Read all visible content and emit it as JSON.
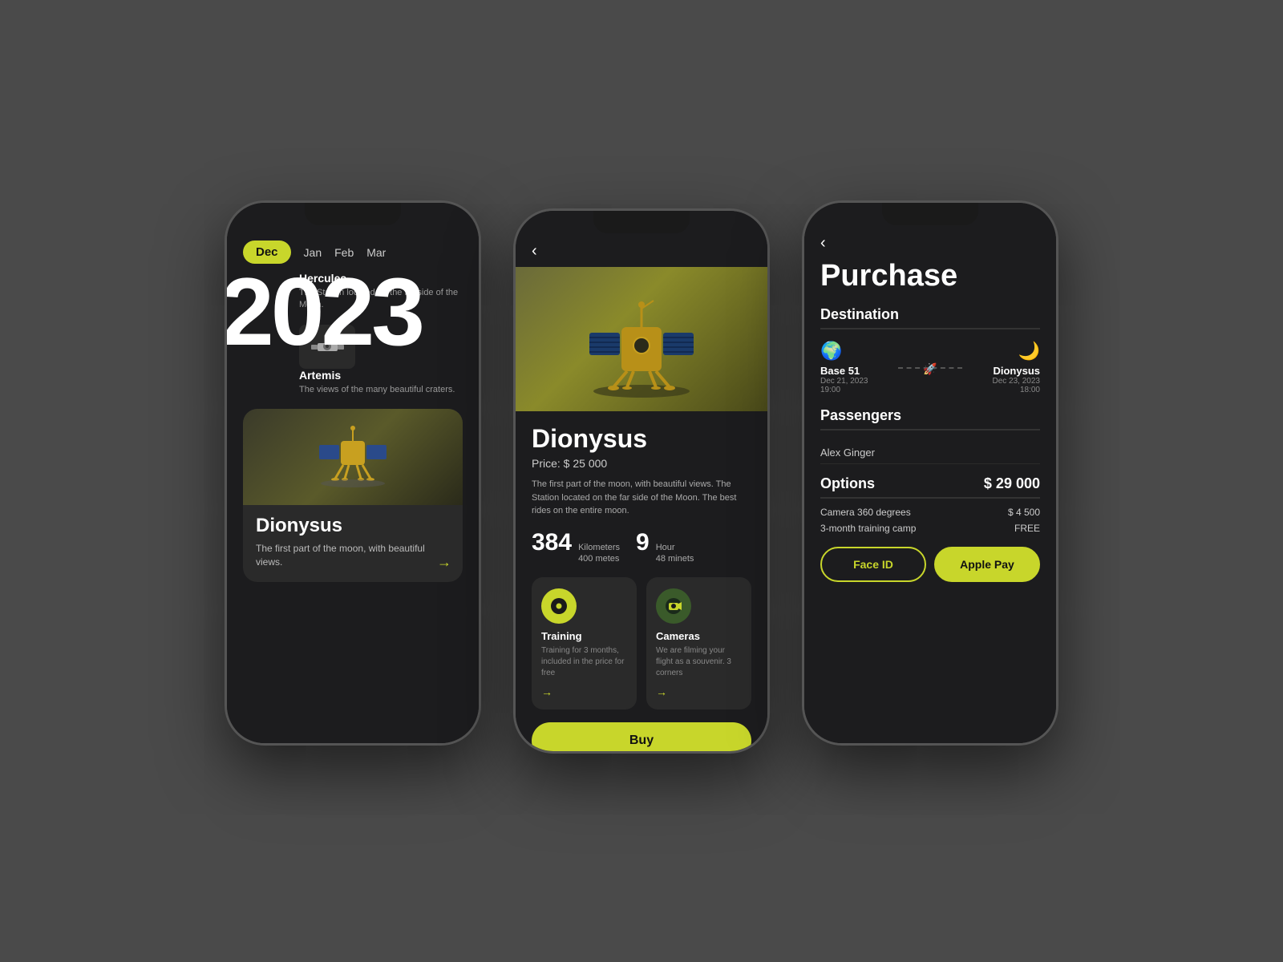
{
  "bg": "#4a4a4a",
  "phone1": {
    "months": [
      "Dec",
      "Jan",
      "Feb",
      "Mar"
    ],
    "active_month": "Dec",
    "year": "2023",
    "missions": [
      {
        "name": "Hercules",
        "desc": "The Station located on the far side of the Moon."
      },
      {
        "name": "Artemis",
        "desc": "The views of the many beautiful craters."
      }
    ],
    "featured": {
      "title": "Dionysus",
      "desc": "The first part of the moon, with beautiful views."
    }
  },
  "phone2": {
    "back_icon": "‹",
    "title": "Dionysus",
    "price": "Price: $ 25 000",
    "desc": "The first part of the moon, with beautiful views. The Station located on the far side of the Moon. The best rides on the entire moon.",
    "stat1_num": "384",
    "stat1_label1": "Kilometers",
    "stat1_label2": "400 metes",
    "stat2_num": "9",
    "stat2_label1": "Hour",
    "stat2_label2": "48 minets",
    "features": [
      {
        "title": "Training",
        "desc": "Training for 3 months, included in the price for free"
      },
      {
        "title": "Cameras",
        "desc": "We are filming your flight as a souvenir. 3 corners"
      }
    ],
    "buy_label": "Buy"
  },
  "phone3": {
    "back_icon": "‹",
    "title": "Purchase",
    "destination_title": "Destination",
    "origin": {
      "icon": "🌍",
      "name": "Base 51",
      "date": "Dec 21, 2023",
      "time": "19:00"
    },
    "destination": {
      "icon": "🌙",
      "name": "Dionysus",
      "date": "Dec 23, 2023",
      "time": "18:00"
    },
    "passengers_title": "Passengers",
    "passenger_name": "Alex Ginger",
    "options_title": "Options",
    "total_price": "$ 29 000",
    "options": [
      {
        "name": "Camera 360 degrees",
        "value": "$ 4 500"
      },
      {
        "name": "3-month training camp",
        "value": "FREE"
      }
    ],
    "btn_face_id": "Face ID",
    "btn_apple_pay": "Apple Pay"
  }
}
